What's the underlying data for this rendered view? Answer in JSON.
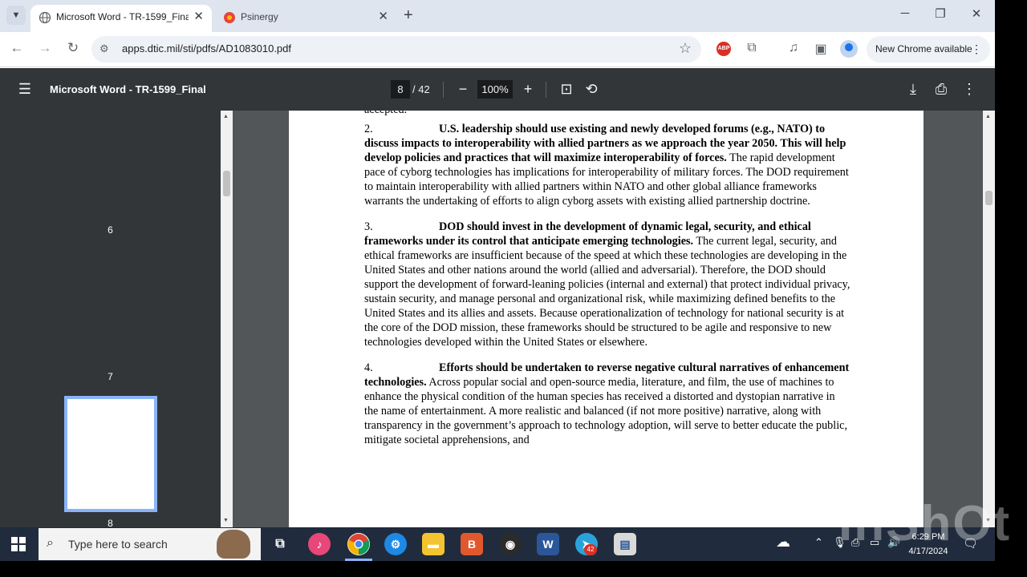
{
  "browser": {
    "tabs": [
      {
        "title": "Microsoft Word - TR-1599_Final",
        "active": true
      },
      {
        "title": "Psinergy",
        "active": false
      }
    ],
    "url": "apps.dtic.mil/sti/pdfs/AD1083010.pdf",
    "update_button": "New Chrome available"
  },
  "pdf": {
    "title": "Microsoft Word - TR-1599_Final",
    "current_page": "8",
    "total_pages": "/ 42",
    "zoom": "100%",
    "thumbnails": [
      "6",
      "7",
      "8"
    ]
  },
  "document": {
    "top_fragment": "accepted.",
    "paragraphs": [
      {
        "num": "2.",
        "bold": "U.S. leadership should use existing and newly developed forums (e.g., NATO) to discuss impacts to interoperability with allied partners as we approach the year 2050. This will help develop policies and practices that will maximize interoperability of forces.",
        "text": " The rapid development pace of cyborg technologies has implications for interoperability of military forces. The DOD requirement to maintain interoperability with allied partners within NATO and other global alliance frameworks warrants the undertaking of efforts to align cyborg assets with existing allied partnership doctrine."
      },
      {
        "num": "3.",
        "bold": "DOD should invest in the development of dynamic legal, security, and ethical frameworks under its control that anticipate emerging technologies.",
        "text": " The current legal, security, and ethical frameworks are insufficient because of the speed at which these technologies are developing in the United States and other nations around the world (allied and adversarial). Therefore, the DOD should support the development of forward-leaning policies (internal and external) that protect individual privacy, sustain security, and manage personal and organizational risk, while maximizing defined benefits to the United States and its allies and assets. Because operationalization of technology for national security is at the core of the DOD mission, these frameworks should be structured to be agile and responsive to new technologies developed within the United States or elsewhere."
      },
      {
        "num": "4.",
        "bold": "Efforts should be undertaken to reverse negative cultural narratives of enhancement technologies.",
        "text": " Across popular social and open-source media, literature, and film, the use of machines to enhance the physical condition of the human species has received a distorted and dystopian narrative in the name of entertainment. A more realistic and balanced (if not more positive) narrative, along with transparency in the government’s approach to technology adoption, will serve to better educate the public, mitigate societal apprehensions, and"
      }
    ]
  },
  "taskbar": {
    "search_placeholder": "Type here to search",
    "badge_count": "42",
    "time": "6:29 PM",
    "date": "4/17/2024"
  },
  "watermark": "InShOt",
  "colors": {
    "pdf_toolbar": "#323639",
    "viewer_bg": "#525659",
    "taskbar": "#202c3d",
    "thumb_highlight": "#8ab4f8"
  }
}
